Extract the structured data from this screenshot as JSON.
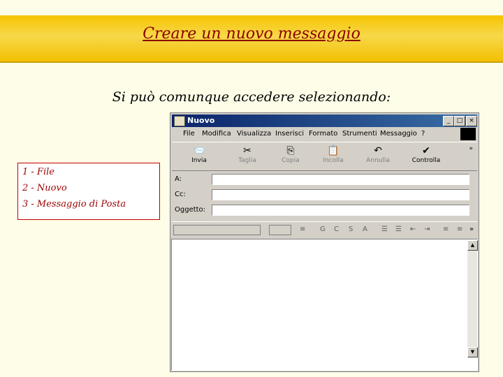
{
  "slide": {
    "title": "Creare un nuovo messaggio",
    "subtitle": "Si può comunque accedere selezionando:",
    "steps": [
      "1 - File",
      "2 - Nuovo",
      "3 - Messaggio di Posta"
    ]
  },
  "window": {
    "title": "Nuovo",
    "buttons": {
      "minimize": "_",
      "maximize": "□",
      "close": "×"
    },
    "menu": [
      "File",
      "Modifica",
      "Visualizza",
      "Inserisci",
      "Formato",
      "Strumenti",
      "Messaggio",
      "?"
    ],
    "toolbar": [
      {
        "label": "Invia",
        "icon": "send-icon",
        "glyph": "📨",
        "enabled": true
      },
      {
        "label": "Taglia",
        "icon": "scissors-icon",
        "glyph": "✂",
        "enabled": false
      },
      {
        "label": "Copia",
        "icon": "copy-icon",
        "glyph": "⎘",
        "enabled": false
      },
      {
        "label": "Incolla",
        "icon": "paste-icon",
        "glyph": "📋",
        "enabled": false
      },
      {
        "label": "Annulla",
        "icon": "undo-icon",
        "glyph": "↶",
        "enabled": false
      },
      {
        "label": "Controlla",
        "icon": "check-names-icon",
        "glyph": "✔",
        "enabled": true
      }
    ],
    "chevron": "»",
    "fields": {
      "to_label": "A:",
      "cc_label": "Cc:",
      "subject_label": "Oggetto:"
    },
    "format_icons": [
      "≡",
      "G",
      "C",
      "S",
      "A",
      "☰",
      "☰",
      "⇤",
      "⇥",
      "≡",
      "≡",
      "≡"
    ],
    "format_chevron": "»"
  }
}
